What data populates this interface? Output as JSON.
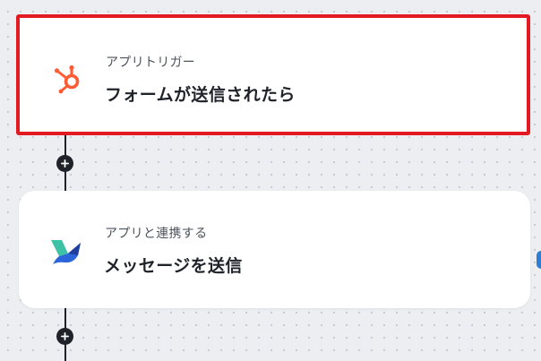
{
  "flow": {
    "steps": [
      {
        "label": "アプリトリガー",
        "title": "フォームが送信されたら",
        "app_icon": "hubspot-icon",
        "highlighted": true,
        "highlight_color": "#e21b23"
      },
      {
        "label": "アプリと連携する",
        "title": "メッセージを送信",
        "app_icon": "messaging-bird-icon"
      }
    ],
    "add_step_icon": "plus-icon"
  },
  "colors": {
    "background": "#eceef2",
    "hubspot_orange": "#ff5c35",
    "connector": "#1f2329",
    "accent_blue": "#2b7fd4"
  }
}
